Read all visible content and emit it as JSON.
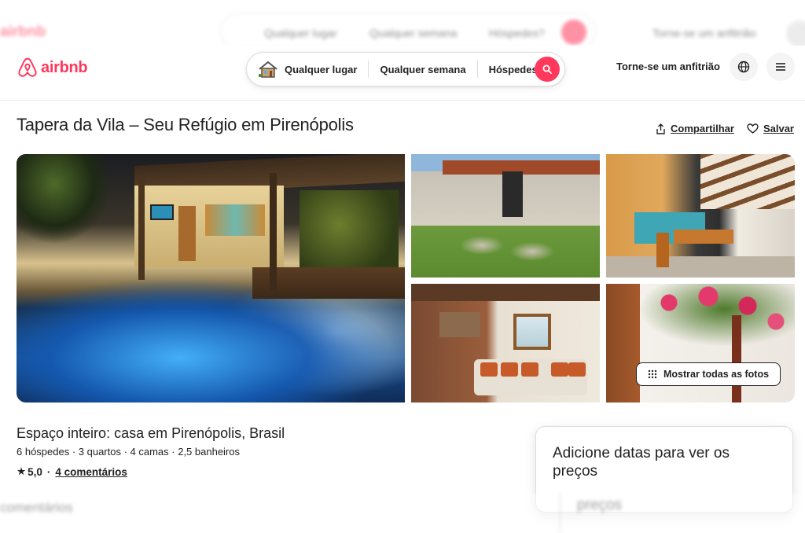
{
  "brand": {
    "name": "airbnb",
    "color": "#FF385C"
  },
  "search": {
    "house_icon": "house-icon",
    "where": "Qualquer lugar",
    "when": "Qualquer semana",
    "guests": "Hóspedes?",
    "button_icon": "search-icon"
  },
  "header": {
    "host_link": "Torne-se um anfitrião",
    "globe_icon": "globe-icon",
    "menu_icon": "hamburger-menu-icon"
  },
  "listing": {
    "title": "Tapera da Vila – Seu Refúgio em Pirenópolis",
    "share_label": "Compartilhar",
    "save_label": "Salvar",
    "show_all_photos": "Mostrar todas as fotos",
    "subtitle": "Espaço inteiro: casa em Pirenópolis, Brasil",
    "facts": "6 hóspedes · 3 quartos · 4 camas · 2,5 banheiros",
    "rating_star": "★",
    "rating_value": "5,0",
    "rating_sep": "·",
    "reviews_link": "4 comentários"
  },
  "booking_card": {
    "title": "Adicione datas para ver os preços"
  },
  "ghost": {
    "top_logo": "airbnb",
    "top_where": "Qualquer lugar",
    "top_when": "Qualquer semana",
    "top_guests": "Hóspedes?",
    "top_host": "Torne-se um anfitrião",
    "bottom_left": "comentários",
    "bottom_right": "preços"
  }
}
